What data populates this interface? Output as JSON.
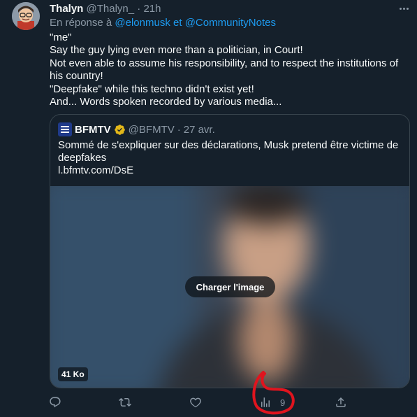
{
  "tweet": {
    "author_name": "Thalyn",
    "author_handle": "@Thalyn_",
    "separator": "·",
    "time": "21h",
    "reply_prefix": "En réponse à",
    "reply_mention_1": "@elonmusk",
    "reply_and": "et",
    "reply_mention_2": "@CommunityNotes",
    "lines": [
      "\"me\"",
      "Say the guy lying even more than a politician, in Court!",
      "Not even able to assume his responsibility, and to respect the institutions of his country!",
      "\"Deepfake\" while this techno didn't exist yet!",
      "And... Words spoken recorded by various media..."
    ]
  },
  "quote": {
    "name": "BFMTV",
    "handle": "@BFMTV",
    "separator": "·",
    "time": "27 avr.",
    "text": "Sommé de s'expliquer sur des déclarations, Musk pretend être victime de deepfakes",
    "link": "l.bfmtv.com/DsE",
    "load_image_label": "Charger l'image",
    "media_size": "41 Ko"
  },
  "actions": {
    "views_count": "9"
  },
  "icons": {
    "avatar": "avatar-image",
    "more": "more-icon",
    "verified": "verified-badge-icon",
    "reply": "reply-icon",
    "retweet": "retweet-icon",
    "like": "like-icon",
    "views": "views-icon",
    "share": "share-icon"
  },
  "colors": {
    "background": "#15202b",
    "text": "#f7f9f9",
    "secondary": "#8b98a5",
    "link": "#1d9bf0",
    "border": "#38444d",
    "verified_gold": "#e2b719",
    "annotation_red": "#e0141e"
  }
}
